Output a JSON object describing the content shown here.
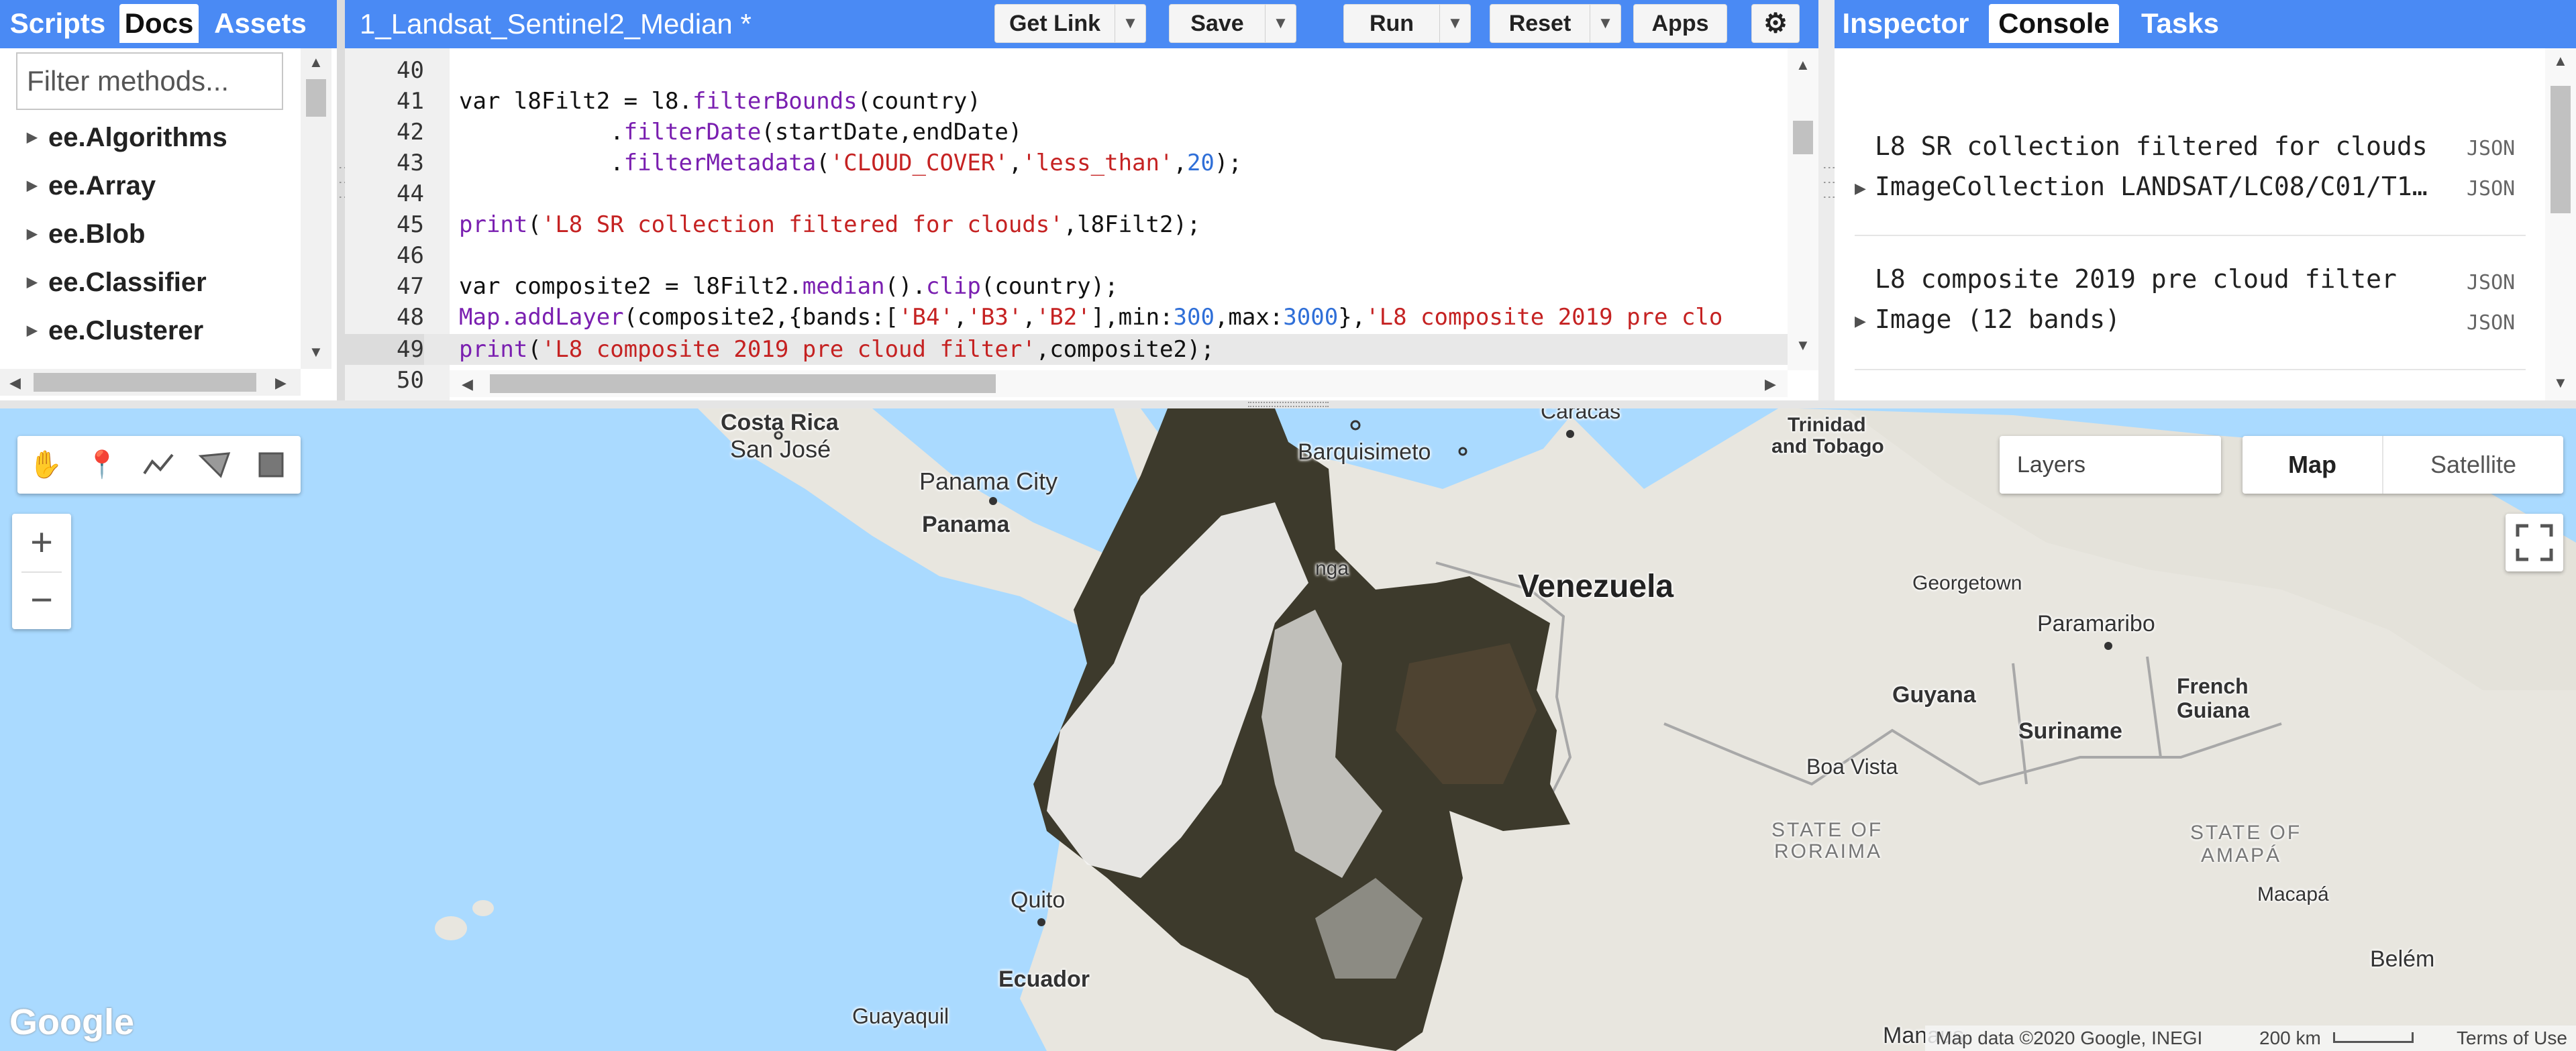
{
  "left_panel": {
    "tabs": [
      "Scripts",
      "Docs",
      "Assets"
    ],
    "active_tab": "Docs",
    "filter_placeholder": "Filter methods...",
    "doc_items": [
      "ee.Algorithms",
      "ee.Array",
      "ee.Blob",
      "ee.Classifier",
      "ee.Clusterer"
    ]
  },
  "editor": {
    "file_title": "1_Landsat_Sentinel2_Median *",
    "buttons": {
      "get_link": "Get Link",
      "save": "Save",
      "run": "Run",
      "reset": "Reset",
      "apps": "Apps"
    },
    "line_numbers": [
      "40",
      "41",
      "42",
      "43",
      "44",
      "45",
      "46",
      "47",
      "48",
      "49",
      "50"
    ],
    "highlighted_line": "49"
  },
  "right_panel": {
    "tabs": [
      "Inspector",
      "Console",
      "Tasks"
    ],
    "active_tab": "Console",
    "entries": [
      {
        "title": "L8 SR collection filtered for clouds",
        "tag1": "JSON",
        "detail": "ImageCollection LANDSAT/LC08/C01/T1…",
        "tag2": "JSON"
      },
      {
        "title": "L8 composite 2019 pre cloud filter",
        "tag1": "JSON",
        "detail": "Image (12 bands)",
        "tag2": "JSON"
      }
    ]
  },
  "map": {
    "layers_label": "Layers",
    "map_type_options": [
      "Map",
      "Satellite"
    ],
    "active_map_type": "Map",
    "zoom_in": "+",
    "zoom_out": "−",
    "tools": [
      "hand-icon",
      "point-icon",
      "line-icon",
      "polygon-icon",
      "rectangle-icon"
    ],
    "labels": {
      "costa_rica": "Costa Rica",
      "san_jose": "San José",
      "panama_city": "Panama City",
      "panama": "Panama",
      "barquisimeto": "Barquisimeto",
      "caracas": "Caracas",
      "trinidad": "Trinidad",
      "and_tobago": "and Tobago",
      "venezuela": "Venezuela",
      "georgetown": "Georgetown",
      "paramaribo": "Paramaribo",
      "french": "French",
      "guiana": "Guiana",
      "guyana": "Guyana",
      "suriname": "Suriname",
      "boa_vista": "Boa Vista",
      "state_of_roraima_1": "STATE OF",
      "state_of_roraima_2": "RORAIMA",
      "state_of_amapa_1": "STATE OF",
      "state_of_amapa_2": "AMAPÁ",
      "macapa": "Macapá",
      "quito": "Quito",
      "ecuador": "Ecuador",
      "guayaquil": "Guayaquil",
      "belem": "Belém",
      "manaus": "Manaus",
      "nga": "nga"
    },
    "attribution": "Map data ©2020 Google, INEGI",
    "scale": "200 km",
    "terms": "Terms of Use",
    "logo": "Google"
  },
  "colors": {
    "header_blue": "#4a8af4",
    "water": "#aadaff",
    "land": "#e8e6df",
    "string": "#c52222",
    "function": "#7a1fb0",
    "number": "#2f6fd8"
  }
}
